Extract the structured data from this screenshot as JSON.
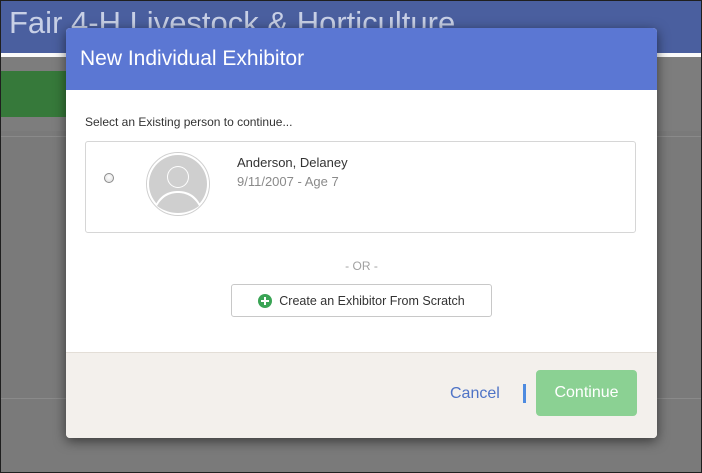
{
  "background": {
    "page_title": "Fair 4-H Livestock & Horticulture"
  },
  "modal": {
    "title": "New Individual Exhibitor",
    "prompt": "Select an Existing person to continue...",
    "persons": [
      {
        "name": "Anderson, Delaney",
        "details": "9/11/2007 - Age 7",
        "selected": false
      }
    ],
    "or_divider": "- OR -",
    "create_label": "Create an Exhibitor From Scratch",
    "cancel_label": "Cancel",
    "continue_label": "Continue"
  },
  "icons": {
    "avatar": "default-person-avatar",
    "create": "plus-circle-icon"
  },
  "colors": {
    "header": "#5b77d3",
    "continue_button": "#8bd193",
    "create_icon": "#3aa455",
    "cancel_link": "#4e73c6"
  }
}
